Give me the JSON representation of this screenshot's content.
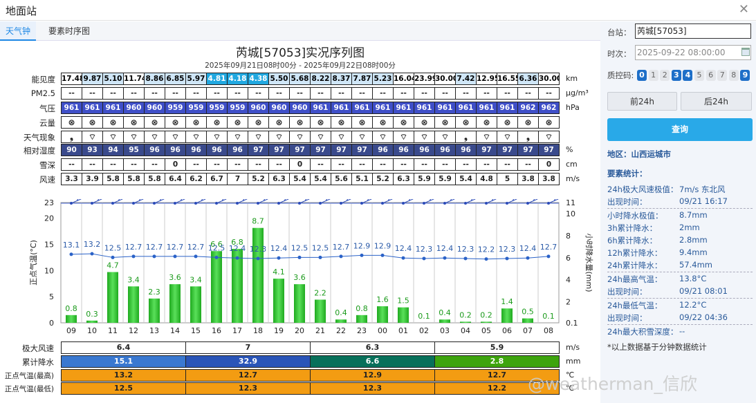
{
  "window": {
    "title": "地面站",
    "close": "✕"
  },
  "tabs": [
    {
      "label": "天气钟"
    },
    {
      "label": "要素时序图"
    }
  ],
  "chart": {
    "title": "芮城[57053]实况序列图",
    "subtitle": "2025年09月21日08时00分 - 2025年09月22日08时00分"
  },
  "rows": {
    "vis": {
      "label": "能见度",
      "unit": "km",
      "values": [
        "17.48",
        "9.87",
        "5.10",
        "11.74",
        "8.86",
        "6.85",
        "5.97",
        "4.81",
        "4.18",
        "4.38",
        "5.50",
        "5.68",
        "8.22",
        "8.37",
        "7.87",
        "5.23",
        "16.04",
        "23.99",
        "30.00",
        "7.42",
        "12.95",
        "16.55",
        "6.36",
        "30.00"
      ],
      "styles": [
        0,
        1,
        1,
        0,
        1,
        1,
        1,
        2,
        2,
        2,
        1,
        1,
        1,
        1,
        1,
        1,
        0,
        0,
        0,
        1,
        0,
        0,
        1,
        0
      ]
    },
    "pm25": {
      "label": "PM2.5",
      "unit": "μg/m³",
      "values": [
        "--",
        "--",
        "--",
        "--",
        "--",
        "--",
        "--",
        "--",
        "--",
        "--",
        "--",
        "--",
        "--",
        "--",
        "--",
        "--",
        "--",
        "--",
        "--",
        "--",
        "--",
        "--",
        "--",
        "--"
      ]
    },
    "pres": {
      "label": "气压",
      "unit": "hPa",
      "values": [
        "961",
        "961",
        "961",
        "960",
        "960",
        "959",
        "959",
        "959",
        "959",
        "960",
        "960",
        "960",
        "961",
        "961",
        "961",
        "961",
        "961",
        "961",
        "961",
        "961",
        "961",
        "961",
        "962",
        "962"
      ]
    },
    "cloud": {
      "label": "云量",
      "unit": "",
      "values": [
        "⊗",
        "⊗",
        "⊗",
        "⊗",
        "⊗",
        "⊗",
        "⊗",
        "⊗",
        "⊗",
        "⊗",
        "⊗",
        "⊗",
        "⊗",
        "⊗",
        "⊗",
        "⊗",
        "⊗",
        "⊗",
        "⊗",
        "⊗",
        "⊗",
        "⊗",
        "⊗",
        "⊗"
      ]
    },
    "wx": {
      "label": "天气现象",
      "unit": "",
      "values": [
        "❟",
        "⌔",
        "⌔",
        "⌔",
        "⌔",
        "⌔",
        "⌔",
        "⌔",
        "⌔",
        "⌔",
        "⌔",
        "⌔",
        "⌔",
        "⌔",
        "⌔",
        "⌔",
        "⌔",
        "⌔",
        "⌔",
        "❟",
        "⌔",
        "⌔",
        "❟",
        "⌔"
      ]
    },
    "rh": {
      "label": "相对湿度",
      "unit": "%",
      "values": [
        "90",
        "93",
        "94",
        "95",
        "96",
        "96",
        "96",
        "96",
        "96",
        "97",
        "97",
        "97",
        "97",
        "97",
        "97",
        "96",
        "96",
        "96",
        "96",
        "96",
        "97",
        "97",
        "97",
        "97"
      ]
    },
    "snow": {
      "label": "雪深",
      "unit": "cm",
      "values": [
        "--",
        "--",
        "--",
        "--",
        "--",
        "0",
        "--",
        "--",
        "--",
        "--",
        "--",
        "0",
        "--",
        "--",
        "--",
        "--",
        "--",
        "--",
        "--",
        "--",
        "--",
        "--",
        "--",
        "0"
      ]
    },
    "wind": {
      "label": "风速",
      "unit": "m/s",
      "values": [
        "3.3",
        "3.9",
        "5.8",
        "5.8",
        "5.8",
        "6.4",
        "6.2",
        "6.7",
        "7",
        "5.2",
        "6.3",
        "5.4",
        "5.4",
        "5.6",
        "5.1",
        "5.2",
        "6.3",
        "5.9",
        "5.9",
        "5.4",
        "4.8",
        "5",
        "3.8",
        "3.8"
      ]
    }
  },
  "chart_data": {
    "type": "bar",
    "categories": [
      "09",
      "10",
      "11",
      "12",
      "13",
      "14",
      "15",
      "16",
      "17",
      "18",
      "19",
      "20",
      "21",
      "22",
      "23",
      "00",
      "01",
      "02",
      "03",
      "04",
      "05",
      "06",
      "07",
      "08"
    ],
    "series": [
      {
        "values": [
          0.8,
          0.3,
          4.7,
          3.4,
          2.3,
          3.6,
          3.4,
          6.6,
          6.8,
          8.7,
          4.1,
          3.6,
          2.2,
          0.4,
          0.8,
          1.6,
          1.5,
          0.1,
          0.4,
          0.2,
          0.2,
          1.4,
          0.5,
          0.1
        ]
      },
      {
        "values": [
          13.1,
          13.2,
          12.5,
          12.7,
          12.7,
          12.7,
          12.7,
          12.5,
          12.4,
          12.3,
          12.4,
          12.5,
          12.5,
          12.7,
          12.9,
          12.9,
          12.4,
          12.3,
          12.4,
          12.3,
          12.2,
          12.3,
          12.4,
          12.7
        ]
      }
    ],
    "ylabel_left": "正点气温(°C)",
    "ylabel_right": "小时降水量(mm)",
    "left_ticks": [
      "0",
      "5",
      "10",
      "15",
      "20",
      "23"
    ],
    "right_ticks": [
      "0.1",
      "2",
      "4",
      "6",
      "8",
      "10",
      "11"
    ],
    "ylim_left": [
      0,
      23
    ],
    "ylim_right": [
      0.1,
      11
    ],
    "grid": "vertical"
  },
  "summary": {
    "rows": [
      {
        "label": "极大风速",
        "unit": "m/s",
        "values": [
          "6.4",
          "7",
          "6.3",
          "5.9"
        ]
      },
      {
        "label": "累计降水",
        "unit": "mm",
        "values": [
          "15.1",
          "32.9",
          "6.6",
          "2.8"
        ],
        "colors": [
          "#3a78d0",
          "#2a55b8",
          "#08705a",
          "#3ea40e"
        ]
      },
      {
        "label": "正点气温(最高)",
        "unit": "℃",
        "values": [
          "13.2",
          "12.7",
          "12.9",
          "12.7"
        ]
      },
      {
        "label": "正点气温(最低)",
        "unit": "℃",
        "values": [
          "12.5",
          "12.3",
          "12.3",
          "12.2"
        ]
      }
    ]
  },
  "right": {
    "station_label": "台站：",
    "station_value": "芮城[57053]",
    "time_label": "时次：",
    "time_value": "2025-09-22 08:00:00",
    "qc_label": "质控码:",
    "qc": [
      {
        "n": "0",
        "on": true
      },
      {
        "n": "1",
        "on": false
      },
      {
        "n": "2",
        "on": false
      },
      {
        "n": "3",
        "on": true
      },
      {
        "n": "4",
        "on": true
      },
      {
        "n": "5",
        "on": false
      },
      {
        "n": "6",
        "on": false
      },
      {
        "n": "7",
        "on": false
      },
      {
        "n": "8",
        "on": false
      },
      {
        "n": "9",
        "on": true
      }
    ],
    "prev": "前24h",
    "next": "后24h",
    "query": "查询",
    "region": "地区：山西运城市",
    "stats_title": "要素统计：",
    "stats": [
      {
        "k": "24h极大风速极值：",
        "v": "7m/s 东北风"
      },
      {
        "k": "出现时间：",
        "v": "09/21 16:17"
      },
      {
        "k": "小时降水极值：",
        "v": "8.7mm"
      },
      {
        "k": "3h累计降水：",
        "v": "2mm"
      },
      {
        "k": "6h累计降水：",
        "v": "2.8mm"
      },
      {
        "k": "12h累计降水：",
        "v": "9.4mm"
      },
      {
        "k": "24h累计降水：",
        "v": "57.4mm"
      },
      {
        "k": "24h最高气温：",
        "v": "13.8°C"
      },
      {
        "k": "出现时间：",
        "v": "09/21 08:01"
      },
      {
        "k": "24h最低气温：",
        "v": "12.2°C"
      },
      {
        "k": "出现时间：",
        "v": "09/22 04:36"
      },
      {
        "k": "24h最大积雪深度：",
        "v": "--"
      }
    ],
    "note": "*以上数据基于分钟数据统计"
  },
  "watermark": "@weatherman_信欣",
  "colors": {
    "bar": "#3cc83c",
    "line": "#2a62c8",
    "accent": "#29a9e8"
  }
}
